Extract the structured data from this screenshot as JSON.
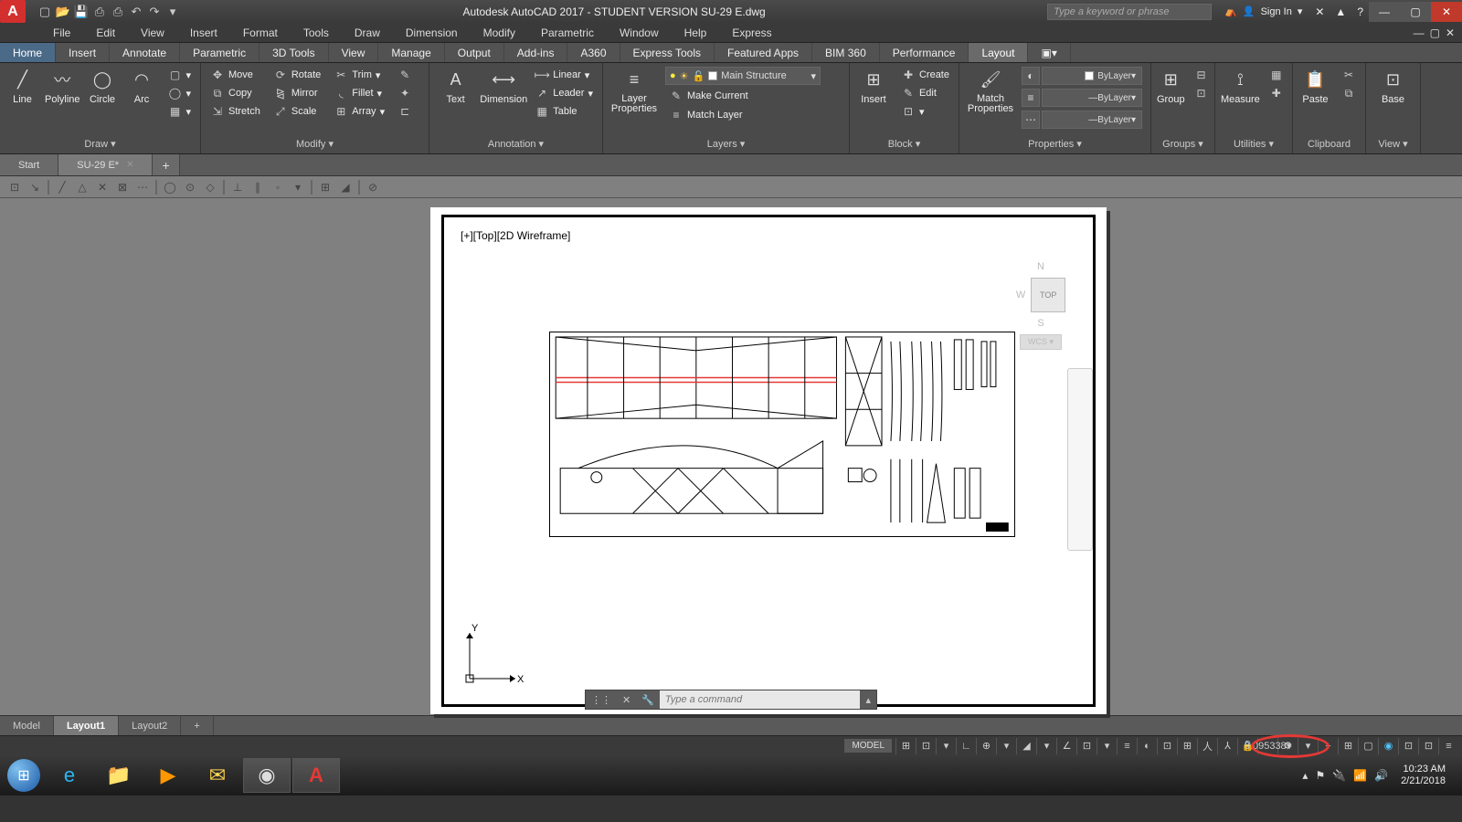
{
  "title": "Autodesk AutoCAD 2017 - STUDENT VERSION   SU-29 E.dwg",
  "search_placeholder": "Type a keyword or phrase",
  "signin": "Sign In",
  "menu": [
    "File",
    "Edit",
    "View",
    "Insert",
    "Format",
    "Tools",
    "Draw",
    "Dimension",
    "Modify",
    "Parametric",
    "Window",
    "Help",
    "Express"
  ],
  "tabs": [
    "Home",
    "Insert",
    "Annotate",
    "Parametric",
    "3D Tools",
    "View",
    "Manage",
    "Output",
    "Add-ins",
    "A360",
    "Express Tools",
    "Featured Apps",
    "BIM 360",
    "Performance",
    "Layout"
  ],
  "panels": {
    "draw": {
      "title": "Draw ▾",
      "btns": [
        "Line",
        "Polyline",
        "Circle",
        "Arc"
      ]
    },
    "modify": {
      "title": "Modify ▾",
      "btns": [
        [
          "Move",
          "Rotate",
          "Trim"
        ],
        [
          "Copy",
          "Mirror",
          "Fillet"
        ],
        [
          "Stretch",
          "Scale",
          "Array"
        ]
      ]
    },
    "annotation": {
      "title": "Annotation ▾",
      "text": "Text",
      "dim": "Dimension",
      "linear": "Linear",
      "leader": "Leader",
      "table": "Table"
    },
    "layers": {
      "title": "Layers ▾",
      "big": "Layer Properties",
      "current": "Main Structure",
      "mc": "Make Current",
      "ml": "Match Layer"
    },
    "block": {
      "title": "Block ▾",
      "ins": "Insert",
      "cr": "Create",
      "ed": "Edit"
    },
    "properties": {
      "title": "Properties ▾",
      "mp": "Match Properties",
      "bylayer": "ByLayer"
    },
    "groups": {
      "title": "Groups ▾",
      "g": "Group"
    },
    "utilities": {
      "title": "Utilities ▾",
      "m": "Measure"
    },
    "clipboard": {
      "title": "Clipboard",
      "p": "Paste"
    },
    "view": {
      "title": "View ▾",
      "b": "Base"
    }
  },
  "doctabs": {
    "start": "Start",
    "file": "SU-29 E*"
  },
  "viewport_label": "[+][Top][2D Wireframe]",
  "viewcube": {
    "top": "TOP",
    "wcs": "WCS",
    "n": "N",
    "s": "S",
    "w": "W"
  },
  "ucs": {
    "x": "X",
    "y": "Y"
  },
  "cmd_placeholder": "Type a command",
  "layout_tabs": [
    "Model",
    "Layout1",
    "Layout2"
  ],
  "status": {
    "model": "MODEL",
    "scale": "0.095338"
  },
  "clock": {
    "time": "10:23 AM",
    "date": "2/21/2018"
  }
}
